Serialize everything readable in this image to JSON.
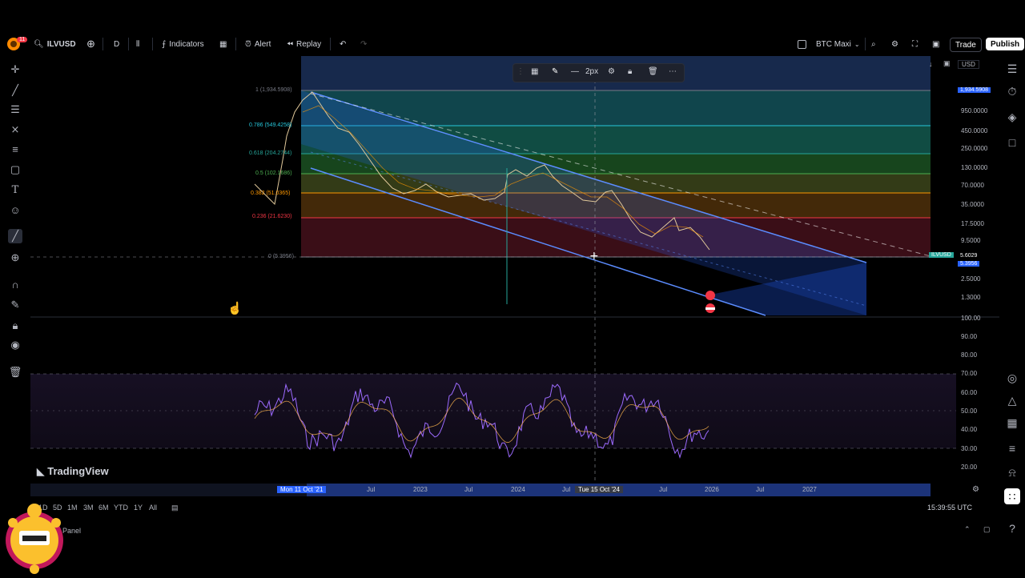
{
  "toolbar": {
    "symbol": "ILVUSD",
    "interval": "D",
    "indicators": "Indicators",
    "alert": "Alert",
    "replay": "Replay",
    "layout_name": "BTC Maxi",
    "trade": "Trade",
    "publish": "Publish",
    "notif_count": "11"
  },
  "draw_toolbar": {
    "stroke_label": "2px"
  },
  "price_scale": {
    "currency": "USD",
    "top_label": "1,934.5908",
    "ticks": [
      "950.0000",
      "450.0000",
      "250.0000",
      "130.0000",
      "70.0000",
      "35.0000",
      "17.5000",
      "9.5000",
      "2.5000",
      "1.3000"
    ],
    "ilv_label": "ILVUSD",
    "last_price": "5.6029",
    "current_line": "5.3956",
    "rsi_ticks": [
      "100.00",
      "90.00",
      "80.00",
      "70.00",
      "60.00",
      "50.00",
      "40.00",
      "30.00",
      "20.00"
    ]
  },
  "fib_levels": [
    {
      "label": "1 (1,934.5908)",
      "color": "#787b86"
    },
    {
      "label": "0.786 (549.4258)",
      "color": "#26c6da"
    },
    {
      "label": "0.618 (204.2744)",
      "color": "#26a69a"
    },
    {
      "label": "0.5 (102.1686)",
      "color": "#4caf50"
    },
    {
      "label": "0.382 (51.0365)",
      "color": "#ff9800"
    },
    {
      "label": "0.236 (21.6230)",
      "color": "#f23645"
    },
    {
      "label": "0 (5.3956)",
      "color": "#787b86"
    }
  ],
  "time_axis": {
    "labels": [
      "Jul",
      "2023",
      "Jul",
      "2024",
      "Jul",
      "Jul",
      "2026",
      "Jul",
      "2027"
    ],
    "hover_start": "Mon 11 Oct '21",
    "hover_crosshair": "Tue 15 Oct '24"
  },
  "watermark": "TradingView",
  "ranges": [
    "1D",
    "5D",
    "1M",
    "3M",
    "6M",
    "YTD",
    "1Y",
    "All"
  ],
  "clock": "15:39:55 UTC",
  "panel_label": "Panel",
  "colors": {
    "accent": "#2962ff",
    "background": "#000000",
    "rsi_band": "#7e57c2",
    "channel": "#2962ff"
  }
}
